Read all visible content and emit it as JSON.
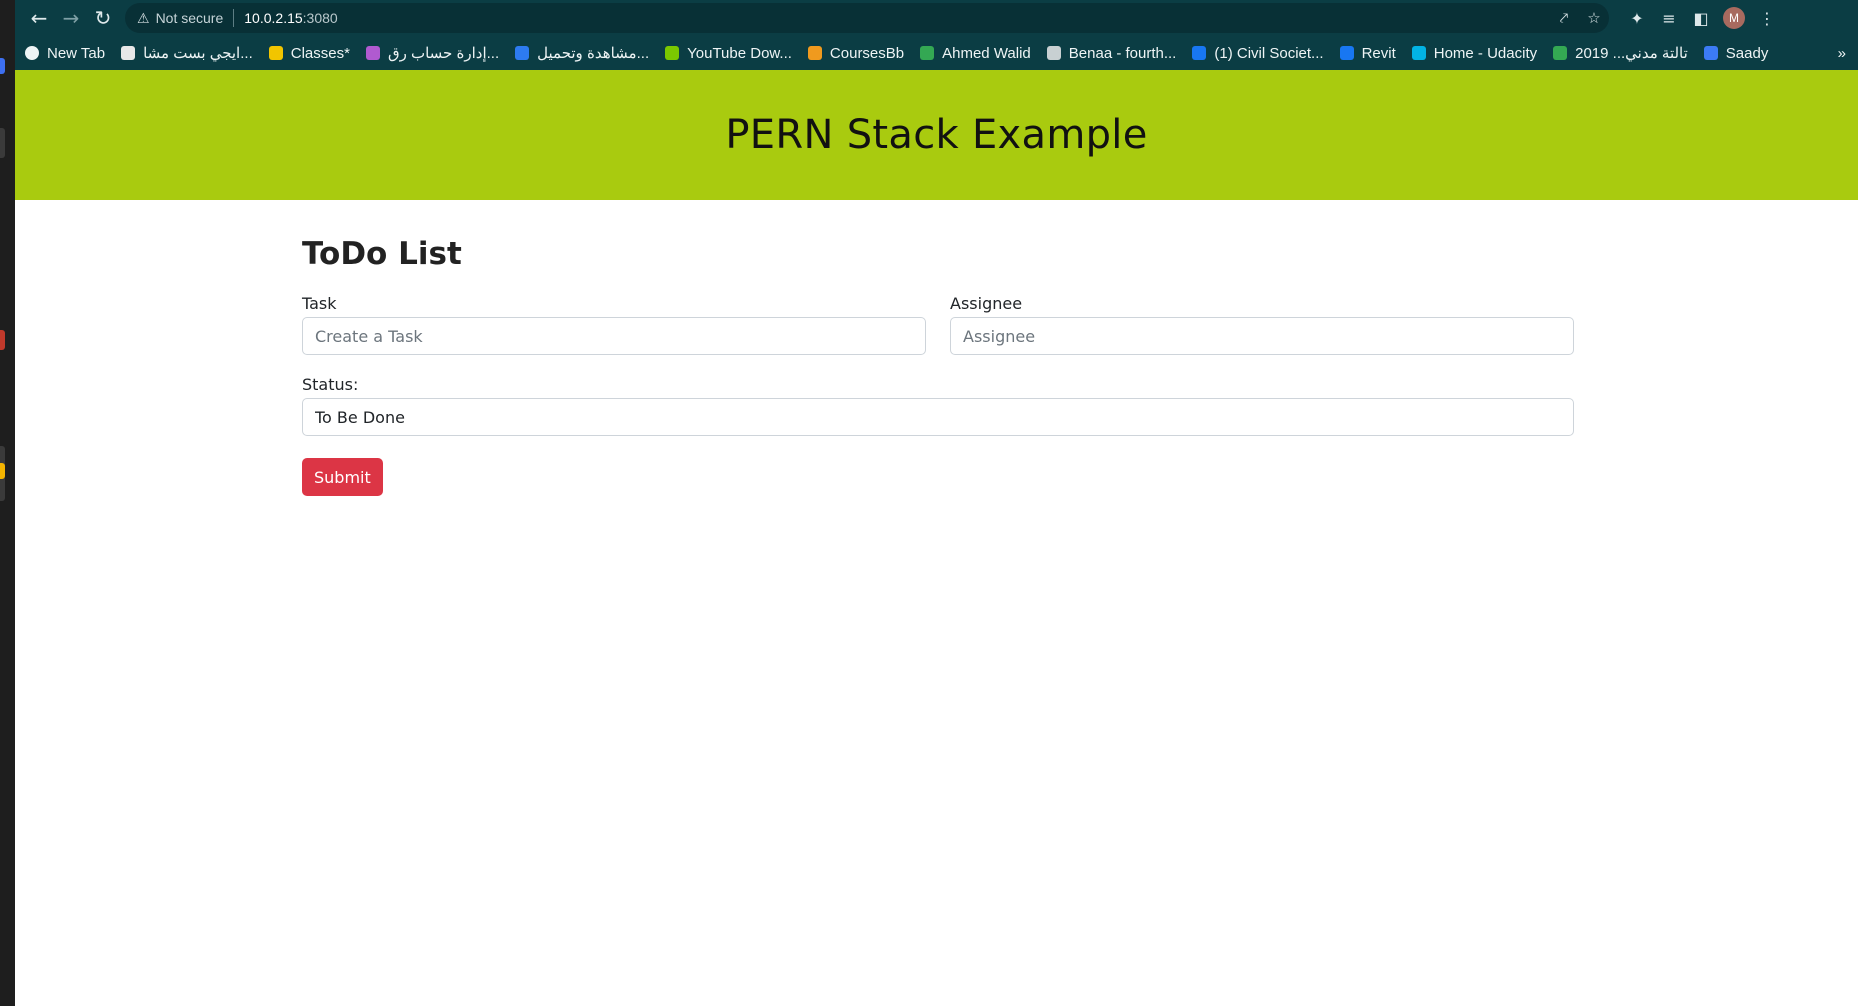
{
  "browser": {
    "security_label": "Not secure",
    "url_host": "10.0.2.15",
    "url_port": ":3080",
    "avatar_letter": "M",
    "bookmarks": [
      {
        "label": "New Tab",
        "color": "#eef4f5"
      },
      {
        "label": "ايجي بست مشا...",
        "color": "#e8e8e8"
      },
      {
        "label": "Classes*",
        "color": "#f2c500"
      },
      {
        "label": "إدارة حساب رق...",
        "color": "#b05ad0"
      },
      {
        "label": "مشاهدة وتحميل...",
        "color": "#2d7bf0"
      },
      {
        "label": "YouTube Dow...",
        "color": "#7bc800"
      },
      {
        "label": "CoursesBb",
        "color": "#f09a1e"
      },
      {
        "label": "Ahmed Walid",
        "color": "#34a853"
      },
      {
        "label": "Benaa - fourth...",
        "color": "#c8d0d2"
      },
      {
        "label": "(1) Civil Societ...",
        "color": "#1877f2"
      },
      {
        "label": "Revit",
        "color": "#1877f2"
      },
      {
        "label": "Home - Udacity",
        "color": "#02b3e4"
      },
      {
        "label": "2019 ...تالتة مدني",
        "color": "#34a853"
      },
      {
        "label": "Saady",
        "color": "#3c7bf5"
      }
    ],
    "bookmarks_more": "»"
  },
  "header": {
    "title": "PERN Stack Example",
    "bg_color": "#a9cb0f"
  },
  "todo": {
    "heading": "ToDo List",
    "task_label": "Task",
    "task_placeholder": "Create a Task",
    "assignee_label": "Assignee",
    "assignee_placeholder": "Assignee",
    "status_label": "Status:",
    "status_value": "To Be Done",
    "submit_label": "Submit",
    "submit_color": "#dc3545"
  }
}
